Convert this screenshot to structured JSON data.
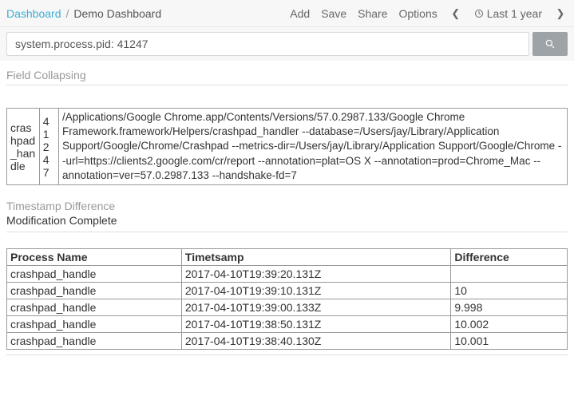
{
  "breadcrumb": {
    "root": "Dashboard",
    "sep": "/",
    "current": "Demo Dashboard"
  },
  "header": {
    "add": "Add",
    "save": "Save",
    "share": "Share",
    "options": "Options",
    "timerange": "Last 1 year"
  },
  "search": {
    "value": "system.process.pid: 41247"
  },
  "section1_label": "Field Collapsing",
  "table1": {
    "name": "crashpad_handle",
    "pid": "41247",
    "cmd": "/Applications/Google Chrome.app/Contents/Versions/57.0.2987.133/Google Chrome Framework.framework/Helpers/crashpad_handler --database=/Users/jay/Library/Application Support/Google/Chrome/Crashpad --metrics-dir=/Users/jay/Library/Application Support/Google/Chrome --url=https://clients2.google.com/cr/report --annotation=plat=OS X --annotation=prod=Chrome_Mac --annotation=ver=57.0.2987.133 --handshake-fd=7"
  },
  "section2_label": "Timestamp Difference",
  "status": "Modification Complete",
  "table2": {
    "headers": {
      "c1": "Process Name",
      "c2": "Timetsamp",
      "c3": "Difference"
    },
    "rows": [
      {
        "name": "crashpad_handle",
        "ts": "2017-04-10T19:39:20.131Z",
        "diff": ""
      },
      {
        "name": "crashpad_handle",
        "ts": "2017-04-10T19:39:10.131Z",
        "diff": "10"
      },
      {
        "name": "crashpad_handle",
        "ts": "2017-04-10T19:39:00.133Z",
        "diff": "9.998"
      },
      {
        "name": "crashpad_handle",
        "ts": "2017-04-10T19:38:50.131Z",
        "diff": "10.002"
      },
      {
        "name": "crashpad_handle",
        "ts": "2017-04-10T19:38:40.130Z",
        "diff": "10.001"
      }
    ]
  }
}
